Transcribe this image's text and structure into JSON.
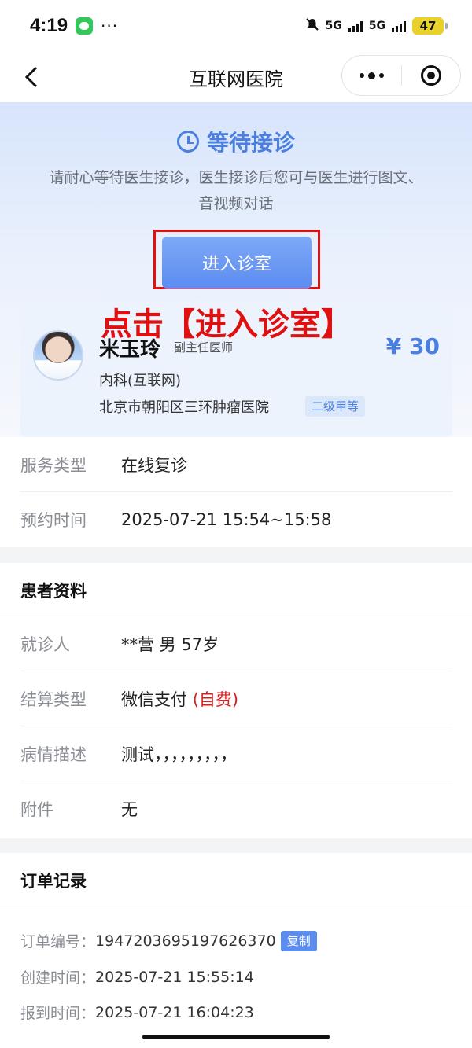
{
  "status_bar": {
    "time": "4:19",
    "dots": "···",
    "network_1": "5G",
    "network_2": "5G",
    "battery": "47"
  },
  "nav": {
    "title": "互联网医院"
  },
  "wait": {
    "title": "等待接诊",
    "desc": "请耐心等待医生接诊，医生接诊后您可与医生进行图文、音视频对话",
    "enter_button": "进入诊室",
    "annotation": "点击【进入诊室】"
  },
  "doctor": {
    "name": "米玉玲",
    "title": "副主任医师",
    "price": "¥ 30",
    "department": "内科(互联网)",
    "hospital": "北京市朝阳区三环肿瘤医院",
    "level": "二级甲等"
  },
  "service": {
    "rows": [
      {
        "label": "服务类型",
        "value": "在线复诊"
      },
      {
        "label": "预约时间",
        "value": "2025-07-21 15:54~15:58"
      }
    ]
  },
  "patient": {
    "header": "患者资料",
    "visitor_label": "就诊人",
    "visitor_value": "**营 男 57岁",
    "settle_label": "结算类型",
    "settle_value": "微信支付",
    "settle_tag": "(自费)",
    "desc_label": "病情描述",
    "desc_value": "测试，，，，，，，，，",
    "attach_label": "附件",
    "attach_value": "无"
  },
  "order": {
    "header": "订单记录",
    "number_label": "订单编号：",
    "number_value": "1947203695197626370",
    "copy_label": "复制",
    "created_label": "创建时间：",
    "created_value": "2025-07-21 15:55:14",
    "checkin_label": "报到时间：",
    "checkin_value": "2025-07-21 16:04:23"
  },
  "colors": {
    "accent": "#4a7fe0",
    "button": "#5b8cf0",
    "annotation": "#e01010",
    "self_pay": "#d81e1e"
  }
}
